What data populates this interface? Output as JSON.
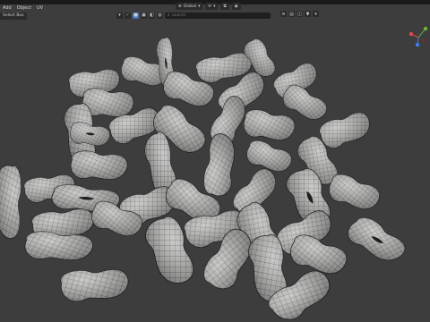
{
  "menu": {
    "add": "Add",
    "object": "Object",
    "uv": "UV"
  },
  "header": {
    "orientation": "Global",
    "select_box": "Select Box"
  },
  "search": {
    "placeholder": "Search"
  },
  "colors": {
    "accent": "#4772b3",
    "axis_x": "#e04848",
    "axis_y": "#6bb33d",
    "axis_z": "#3f7ee8",
    "bean_fill": "#b9bbb8",
    "wire": "#3b3b3b"
  },
  "icons": [
    "dropdown-icon",
    "object-mode-icon",
    "snap-icon",
    "proportional-icon",
    "filter-icon",
    "view-gizmo"
  ]
}
